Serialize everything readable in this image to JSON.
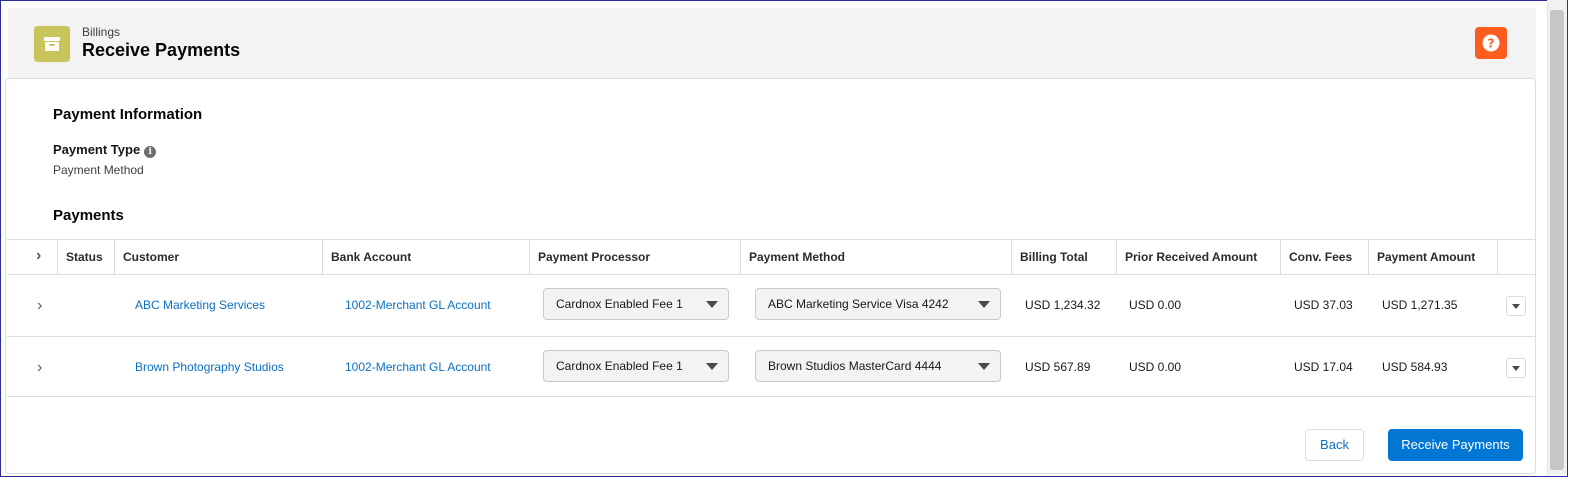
{
  "header": {
    "breadcrumb": "Billings",
    "title": "Receive Payments"
  },
  "payment_info": {
    "section_title": "Payment Information",
    "type_label": "Payment Type",
    "type_value": "Payment Method"
  },
  "payments": {
    "section_title": "Payments",
    "columns": {
      "status": "Status",
      "customer": "Customer",
      "bank_account": "Bank Account",
      "processor": "Payment Processor",
      "method": "Payment Method",
      "billing_total": "Billing Total",
      "prior_received": "Prior Received Amount",
      "conv_fees": "Conv. Fees",
      "payment_amount": "Payment Amount"
    },
    "rows": [
      {
        "customer": "ABC Marketing Services",
        "bank_account": "1002-Merchant GL Account",
        "processor": "Cardnox Enabled Fee 1",
        "method": "ABC Marketing Service Visa 4242",
        "billing_total": "USD 1,234.32",
        "prior_received": "USD 0.00",
        "conv_fees": "USD 37.03",
        "payment_amount": "USD 1,271.35"
      },
      {
        "customer": "Brown Photography Studios",
        "bank_account": "1002-Merchant GL Account",
        "processor": "Cardnox Enabled Fee 1",
        "method": "Brown Studios MasterCard 4444",
        "billing_total": "USD 567.89",
        "prior_received": "USD 0.00",
        "conv_fees": "USD 17.04",
        "payment_amount": "USD 584.93"
      }
    ]
  },
  "actions": {
    "back_label": "Back",
    "receive_label": "Receive Payments"
  },
  "icons": {
    "app": "archive-box-icon",
    "help": "question-circle-icon",
    "info": "info-icon",
    "expand": "chevron-right-icon",
    "dropdown": "caret-down-icon"
  },
  "colors": {
    "app_icon_bg": "#c9c45c",
    "help_icon_bg": "#fe5c1f",
    "brand_button": "#0176d3",
    "link": "#0b6fc4"
  }
}
